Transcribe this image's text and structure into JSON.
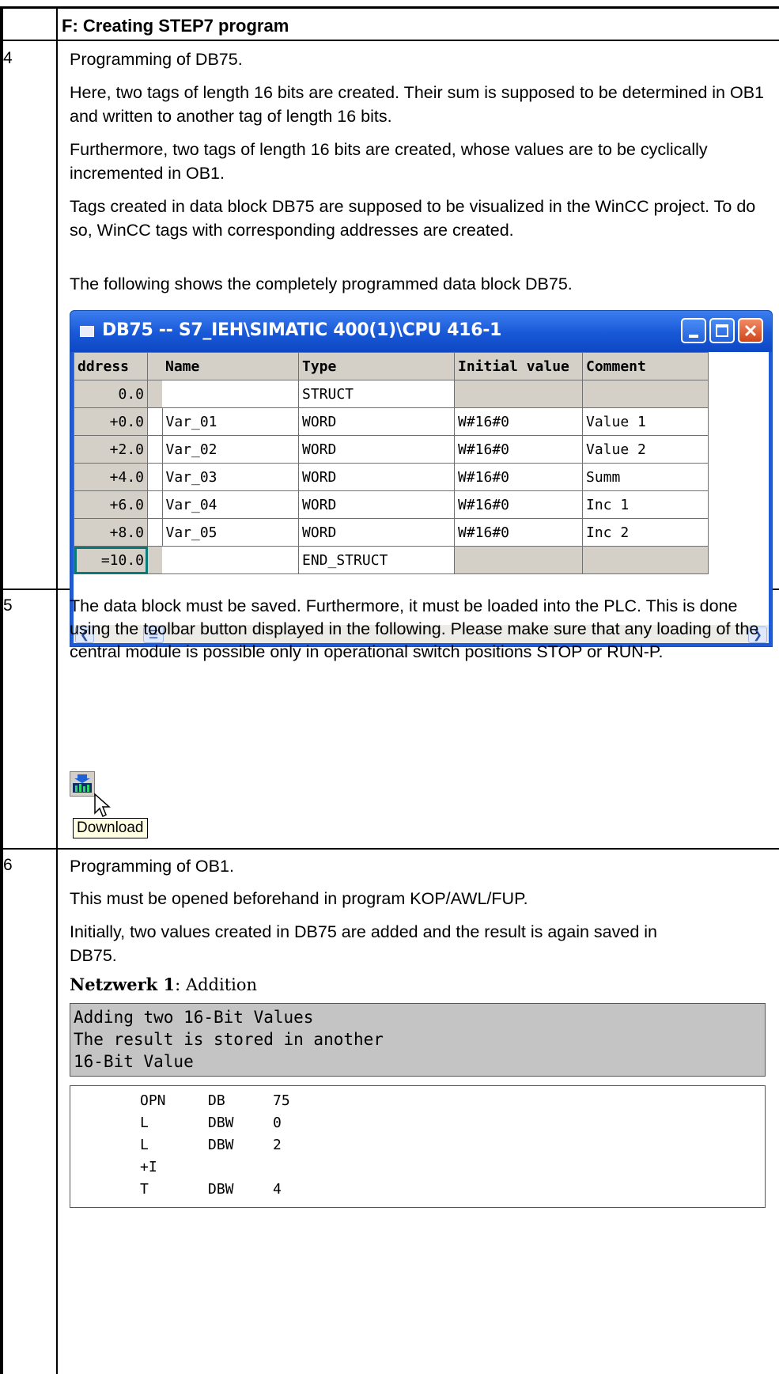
{
  "header": {
    "title": "F: Creating STEP7 program"
  },
  "steps": [
    {
      "number": "4",
      "paragraphs": [
        "Programming of DB75.",
        "Here, two tags of length 16 bits are created. Their sum is supposed to be determined in OB1 and written to another tag of length 16 bits.",
        "Furthermore, two tags of length 16 bits are created, whose values are to be cyclically incremented in OB1.",
        "Tags created in data block DB75 are supposed to be visualized in the WinCC project. To do so, WinCC tags with corresponding addresses are created.",
        "The following shows the completely programmed data block DB75."
      ]
    },
    {
      "number": "5",
      "paragraphs": [
        "The data block must be saved. Furthermore, it must be loaded into the PLC. This is done using the toolbar button displayed in the following. Please make sure that any loading of the central module is possible only in operational switch positions STOP or RUN-P."
      ]
    },
    {
      "number": "6",
      "paragraphs": [
        "Programming of OB1.",
        "This must be opened beforehand in program KOP/AWL/FUP.",
        "Initially, two values created in DB75 are added and the result is again saved in DB75."
      ]
    }
  ],
  "db_window": {
    "title": "DB75 -- S7_IEH\\SIMATIC 400(1)\\CPU 416-1",
    "columns": [
      "ddress",
      "Name",
      "Type",
      "Initial value",
      "Comment"
    ],
    "rows": [
      [
        "0.0",
        "",
        "STRUCT",
        "",
        ""
      ],
      [
        "+0.0",
        "Var_01",
        "WORD",
        "W#16#0",
        "Value 1"
      ],
      [
        "+2.0",
        "Var_02",
        "WORD",
        "W#16#0",
        "Value 2"
      ],
      [
        "+4.0",
        "Var_03",
        "WORD",
        "W#16#0",
        "Summ"
      ],
      [
        "+6.0",
        "Var_04",
        "WORD",
        "W#16#0",
        "Inc 1"
      ],
      [
        "+8.0",
        "Var_05",
        "WORD",
        "W#16#0",
        "Inc 2"
      ],
      [
        "=10.0",
        "",
        "END_STRUCT",
        "",
        ""
      ]
    ]
  },
  "download": {
    "tooltip": "Download"
  },
  "network": {
    "label": "Netzwerk 1",
    "separator": ":",
    "name": "Addition",
    "comment": [
      "Adding two 16-Bit Values",
      "The result is stored in another",
      "16-Bit Value"
    ],
    "code": [
      [
        "OPN",
        "DB",
        "75"
      ],
      [
        "L",
        "DBW",
        "0"
      ],
      [
        "L",
        "DBW",
        "2"
      ],
      [
        "+I",
        "",
        ""
      ],
      [
        "T",
        "DBW",
        "4"
      ]
    ]
  }
}
